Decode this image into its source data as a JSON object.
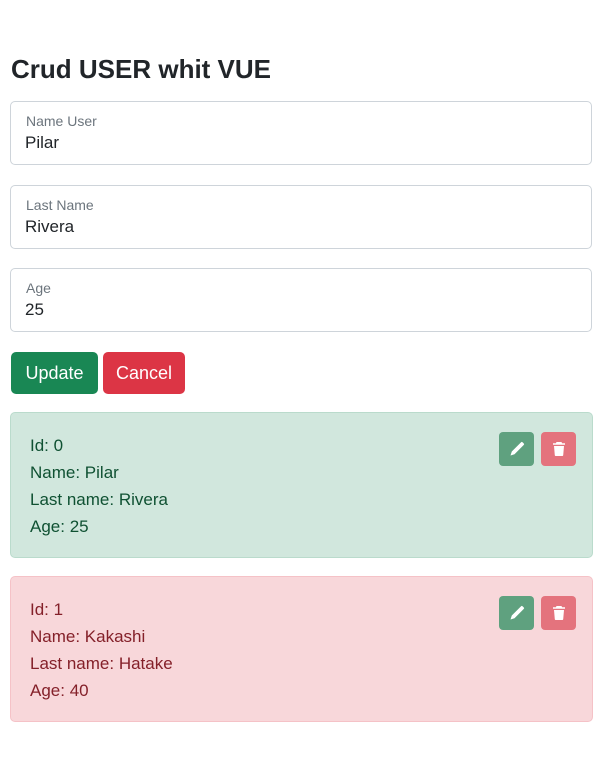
{
  "header": {
    "title": "Crud USER whit VUE"
  },
  "form": {
    "name": {
      "label": "Name User",
      "value": "Pilar"
    },
    "last_name": {
      "label": "Last Name",
      "value": "Rivera"
    },
    "age": {
      "label": "Age",
      "value": "25"
    }
  },
  "actions": {
    "update_label": "Update",
    "cancel_label": "Cancel"
  },
  "labels": {
    "id": "Id: ",
    "name": "Name: ",
    "last_name": "Last name: ",
    "age": "Age: "
  },
  "users": [
    {
      "id": "0",
      "name": "Pilar",
      "last_name": "Rivera",
      "age": "25",
      "status": "success",
      "color": "#d1e7dd"
    },
    {
      "id": "1",
      "name": "Kakashi",
      "last_name": "Hatake",
      "age": "40",
      "status": "danger",
      "color": "#f8d7da"
    }
  ],
  "icons": {
    "edit": "pencil-icon",
    "delete": "trash-icon"
  },
  "colors": {
    "success": "#198754",
    "danger": "#dc3545",
    "edit_button": "#5fa17f",
    "delete_button": "#e4737d"
  }
}
